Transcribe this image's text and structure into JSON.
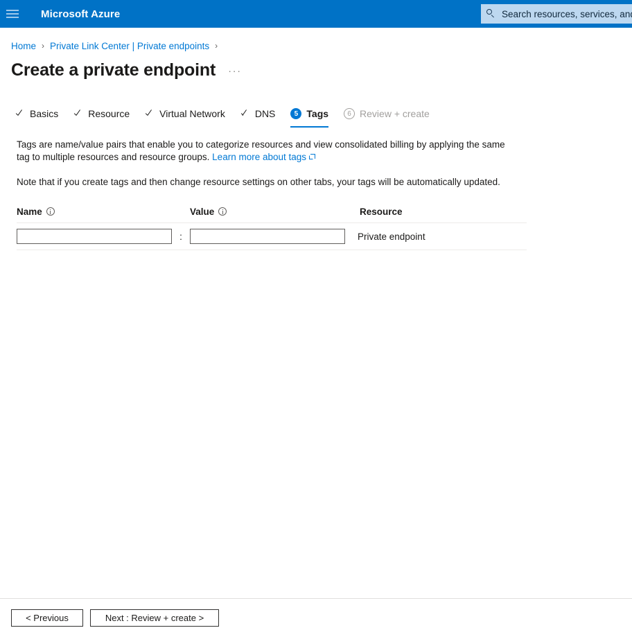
{
  "topbar": {
    "menu_icon": "hamburger-icon",
    "brand": "Microsoft Azure",
    "search_icon": "search-icon",
    "search_placeholder": "Search resources, services, and d"
  },
  "breadcrumb": {
    "items": [
      {
        "label": "Home"
      },
      {
        "label": "Private Link Center | Private endpoints"
      }
    ],
    "separator": "›"
  },
  "header": {
    "title": "Create a private endpoint",
    "ellipsis": "···"
  },
  "wizard": {
    "tabs": [
      {
        "label": "Basics",
        "state": "complete",
        "marker": "check"
      },
      {
        "label": "Resource",
        "state": "complete",
        "marker": "check"
      },
      {
        "label": "Virtual Network",
        "state": "complete",
        "marker": "check"
      },
      {
        "label": "DNS",
        "state": "complete",
        "marker": "check"
      },
      {
        "label": "Tags",
        "state": "active",
        "marker": "5"
      },
      {
        "label": "Review + create",
        "state": "pending",
        "marker": "6"
      }
    ],
    "active_index": 4
  },
  "description": {
    "line1_part1": "Tags are name/value pairs that enable you to categorize resources and view consolidated billing by applying the same tag to multiple resources and resource groups.",
    "learn_more_link": "Learn more about tags",
    "external_icon": "external-link-icon",
    "note": "Note that if you create tags and then change resource settings on other tabs, your tags will be automatically updated."
  },
  "tags_table": {
    "columns": [
      {
        "label": "Name",
        "has_info": true
      },
      {
        "label": "Value",
        "has_info": true
      },
      {
        "label": "Resource",
        "has_info": false
      }
    ],
    "separator": ":",
    "rows": [
      {
        "name_value": "",
        "name_placeholder": "",
        "value_value": "",
        "value_placeholder": "",
        "resource": "Private endpoint"
      }
    ]
  },
  "footer": {
    "previous_label": "< Previous",
    "next_label": "Next : Review + create >"
  },
  "colors": {
    "azure_blue": "#0072c6",
    "accent": "#0078d4",
    "link": "#0078d4",
    "text": "#1b1a19",
    "muted": "#a19f9d",
    "divider": "#edebe9"
  }
}
